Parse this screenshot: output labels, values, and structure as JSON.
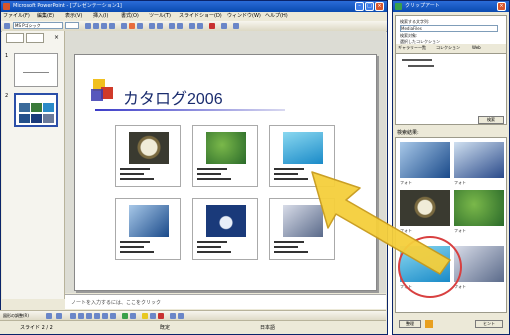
{
  "powerpoint": {
    "title": "Microsoft PowerPoint - [プレゼンテーション1]",
    "menus": [
      "ファイル(F)",
      "編集(E)",
      "表示(V)",
      "挿入(I)",
      "書式(O)",
      "ツール(T)",
      "スライドショー(D)",
      "ウィンドウ(W)",
      "ヘルプ(H)"
    ],
    "toolbar_font": "MS Pゴシック",
    "slides_pane": {
      "thumb_numbers": [
        "1",
        "2"
      ]
    },
    "slide": {
      "title": "カタログ2006"
    },
    "notes_placeholder": "ノートを入力するには、ここをクリック",
    "status": [
      "スライド 2 / 2",
      "既定",
      "日本語"
    ],
    "drawbar_label": "図形の調整(R)"
  },
  "task_pane": {
    "title": "クリップアート",
    "search_lines": [
      "検索する文字列:",
      "MediaFiles",
      "検索対象:",
      "選択したコレクション"
    ],
    "tabs": [
      "ギャラリー一覧",
      "コレクション",
      "Web"
    ],
    "go_label": "検索",
    "results_label": "検索結果:",
    "captions": [
      "フォト",
      "フォト",
      "フォト",
      "フォト",
      "フォト",
      "フォト"
    ],
    "bottom_buttons": [
      "整理",
      "ヒント"
    ]
  },
  "colors": {
    "titlebar": "#0a4bb0",
    "highlight_circle": "#d84040",
    "arrow": "#f5cf3c"
  }
}
